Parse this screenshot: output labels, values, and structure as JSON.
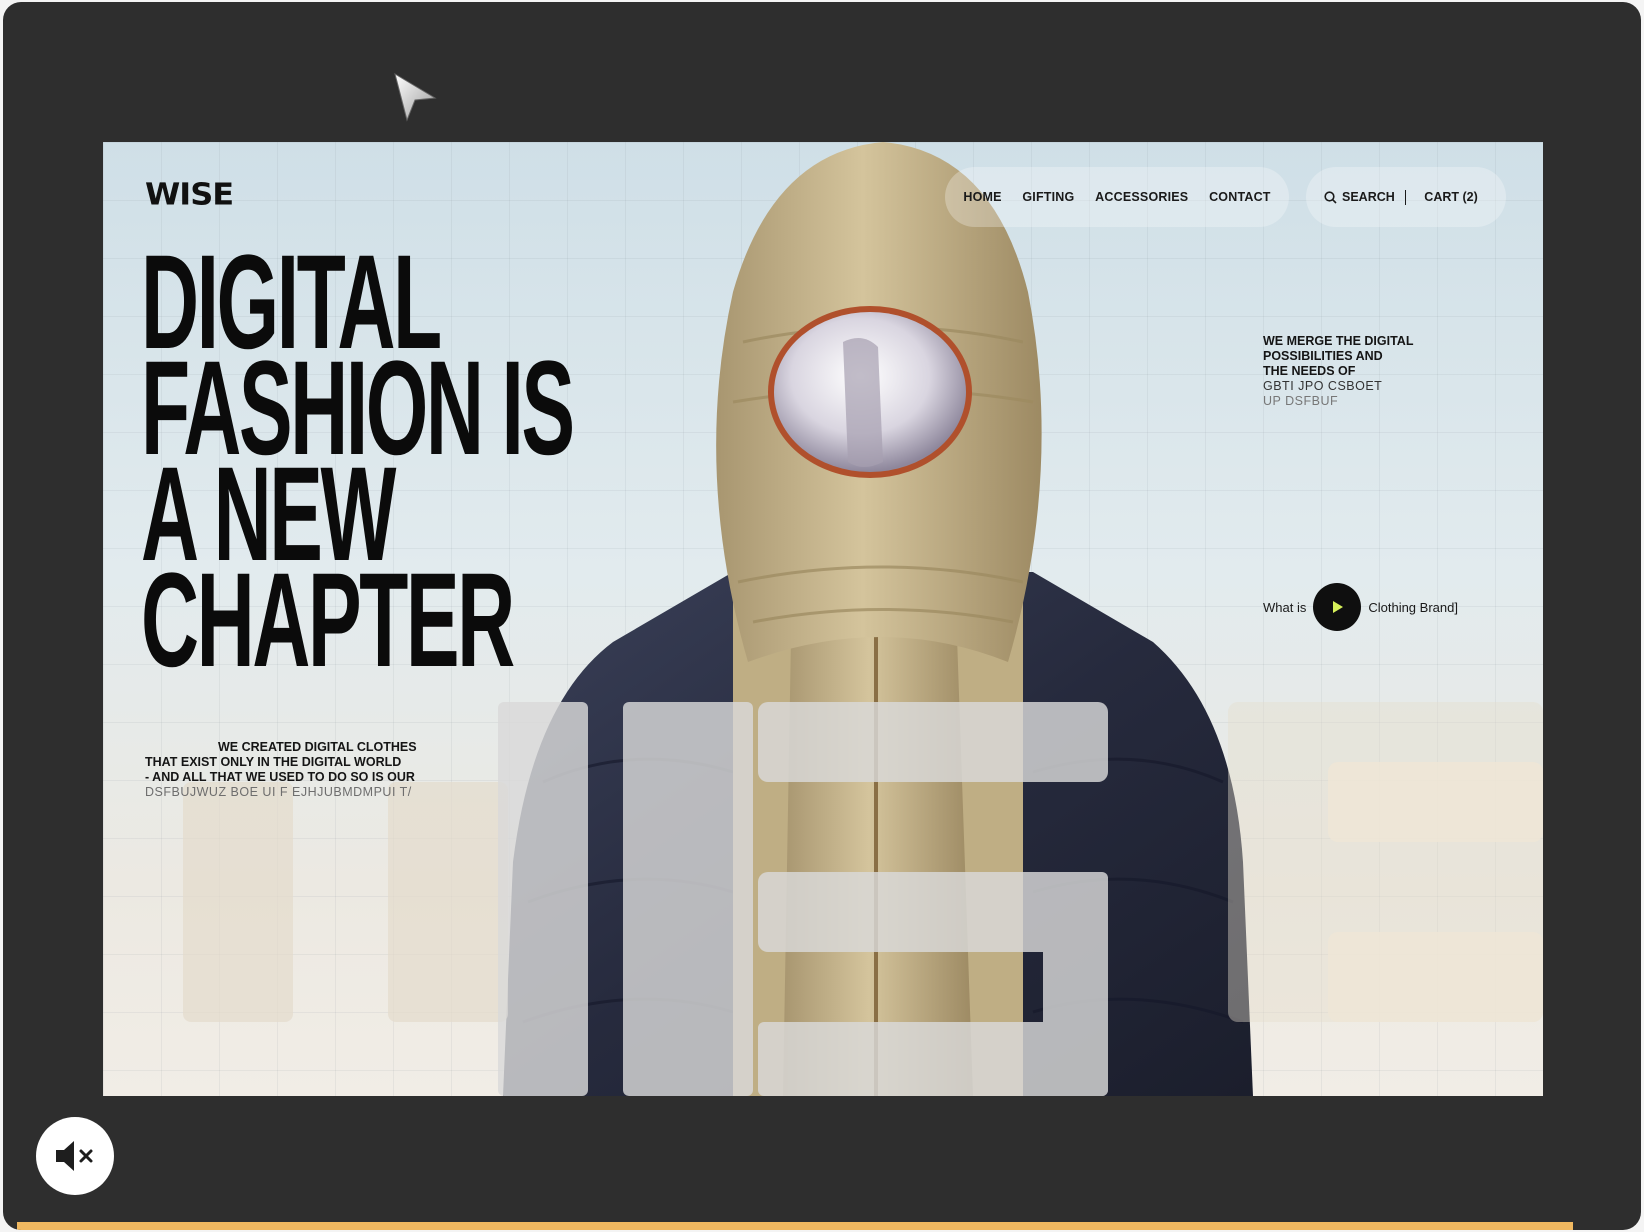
{
  "brand": {
    "logo_text": "WISE"
  },
  "nav": {
    "links": [
      {
        "label": "HOME"
      },
      {
        "label": "GIFTING"
      },
      {
        "label": "ACCESSORIES"
      },
      {
        "label": "CONTACT"
      }
    ],
    "search_label": "SEARCH",
    "cart_label": "CART (2)"
  },
  "hero": {
    "headline_lines": [
      "DIGITAL",
      "FASHION IS",
      "A NEW",
      "CHAPTER"
    ],
    "intro_lines": [
      "WE CREATED DIGITAL CLOTHES",
      "THAT EXIST ONLY IN THE DIGITAL WORLD",
      "- AND ALL THAT WE USED TO DO SO IS OUR",
      "DSFBUJWUZ BOE UI F EJHJUBMDMPUI T/"
    ],
    "aside_lines": [
      "WE MERGE THE DIGITAL",
      "POSSIBILITIES AND",
      "THE NEEDS OF",
      "GBTI JPO CSBOET",
      "UP DSFBUF"
    ],
    "video_cta_prefix": "What is",
    "video_cta_suffix": "Clothing Brand]",
    "watermark_text": "WISE"
  },
  "player": {
    "progress_fraction": 0.95
  },
  "colors": {
    "frame_bg": "#2e2e2e",
    "progress_bar": "#f0b860",
    "accent_play": "#d6f05a",
    "jacket_navy": "#2a2f45",
    "hood_beige": "#c7b68a"
  },
  "icons": {
    "cursor": "cursor-arrow-icon",
    "mute": "speaker-muted-icon",
    "search": "search-icon",
    "play": "play-icon"
  }
}
